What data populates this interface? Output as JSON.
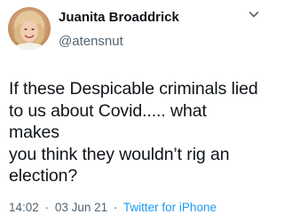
{
  "tweet": {
    "author": {
      "name": "Juanita Broaddrick",
      "handle": "@atensnut"
    },
    "text": "If these Despicable criminals lied\nto us about Covid..... what makes\nyou think they wouldn’t  rig an\nelection?",
    "time": "14:02",
    "separator": "·",
    "date": "03 Jun 21",
    "source": "Twitter for iPhone"
  },
  "icons": {
    "avatar": "profile-photo",
    "menu": "chevron-down-icon"
  },
  "colors": {
    "text": "#0f1419",
    "secondary": "#536471",
    "link": "#1d9bf0"
  }
}
